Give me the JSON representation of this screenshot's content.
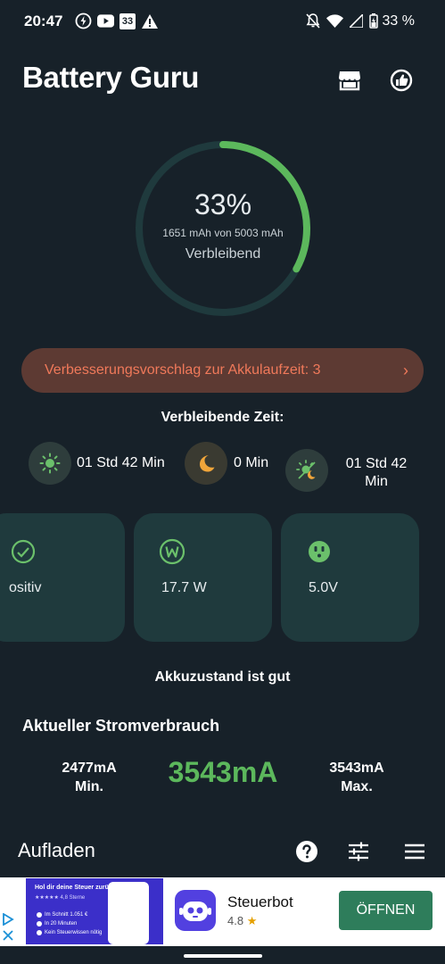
{
  "status_bar": {
    "time": "20:47",
    "notification_icons": [
      "flash-icon",
      "youtube-icon",
      "calendar-33-icon",
      "warning-icon"
    ],
    "calendar_day": "33",
    "battery_text": "33 %",
    "system_icons": [
      "mute-icon",
      "wifi-icon",
      "signal-icon",
      "battery-icon"
    ]
  },
  "header": {
    "title": "Battery Guru",
    "icons": [
      "store-icon",
      "thumbs-up-icon"
    ]
  },
  "battery_ring": {
    "percent_text": "33%",
    "percent_value": 0.33,
    "capacity_text": "1651 mAh von 5003 mAh",
    "label": "Verbleibend",
    "ring_color": "#5cb85c",
    "track_color": "#1f3a3d"
  },
  "suggestion": {
    "text": "Verbesserungsvorschlag zur Akkulaufzeit: 3",
    "chevron": "›"
  },
  "remaining_time": {
    "title": "Verbleibende Zeit:",
    "items": [
      {
        "icon": "sun-icon",
        "value": "01 Std 42 Min"
      },
      {
        "icon": "moon-icon",
        "value": "0 Min"
      },
      {
        "icon": "sun-moon-icon",
        "value": "01 Std 42 Min"
      }
    ]
  },
  "cards": [
    {
      "icon": "positive-icon",
      "value": "ositiv"
    },
    {
      "icon": "watt-icon",
      "value": "17.7 W"
    },
    {
      "icon": "outlet-icon",
      "value": "5.0V"
    }
  ],
  "health_text": "Akkuzustand ist gut",
  "current_usage": {
    "title": "Aktueller Stromverbrauch",
    "min_value": "2477mA",
    "min_label": "Min.",
    "current_value": "3543mA",
    "max_value": "3543mA",
    "max_label": "Max."
  },
  "bottom_bar": {
    "title": "Aufladen",
    "icons": [
      "help-icon",
      "sliders-icon",
      "menu-icon"
    ]
  },
  "ad": {
    "image_title": "Hol dir deine Steuer zurück!",
    "image_rating": "★★★★★ 4,8 Sterne",
    "image_bullets": [
      "Im Schnitt 1.051 €",
      "In 20 Minuten",
      "Kein Steuerwissen nötig"
    ],
    "app_name": "Steuerbot",
    "rating": "4.8 ★",
    "cta": "ÖFFNEN"
  },
  "colors": {
    "background": "#172129",
    "accent_green": "#5cb85c",
    "banner_bg": "#5d3a33",
    "banner_text": "#f0795a",
    "card_bg": "#1f3a3d",
    "icon_green": "#6bc06b",
    "moon_orange": "#f0a53a"
  }
}
